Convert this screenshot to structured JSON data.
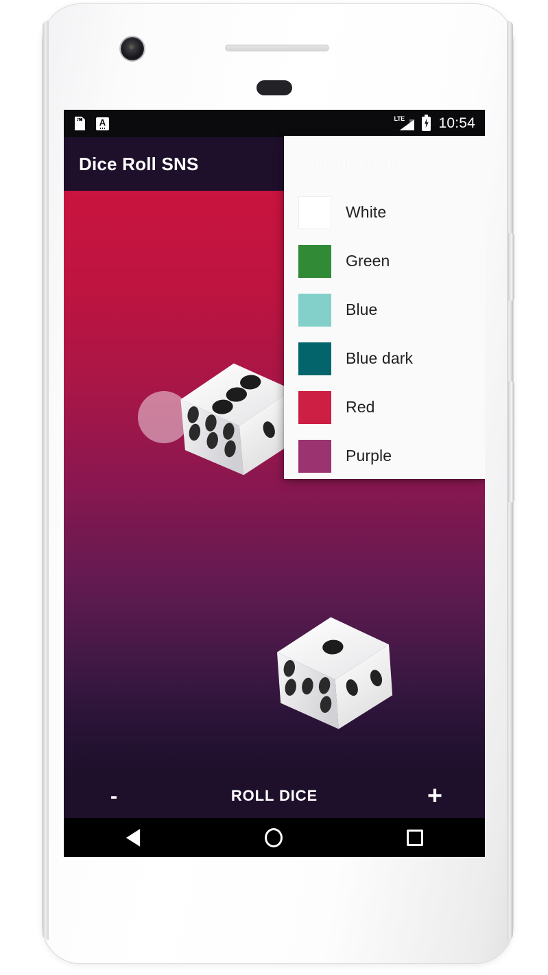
{
  "app": {
    "title": "Dice Roll SNS",
    "accent_bar_color": "#1e0f2b",
    "background_gradient_top": "#c8143f",
    "background_gradient_bottom": "#1e0f2b"
  },
  "status_bar": {
    "clock": "10:54",
    "network_label": "LTE",
    "icons": [
      "sd-card-icon",
      "auto-brightness-icon",
      "lte-signal-icon",
      "battery-charging-icon"
    ]
  },
  "dice": [
    {
      "name": "die-one",
      "top_face": 3,
      "left_face": 6,
      "right_face": 1
    },
    {
      "name": "die-two",
      "top_face": 1,
      "left_face": 5,
      "right_face": 2
    }
  ],
  "action_bar": {
    "minus_label": "-",
    "roll_label": "ROLL DICE",
    "plus_label": "+"
  },
  "nav_bar": {
    "back_label": "Back",
    "home_label": "Home",
    "recents_label": "Recents"
  },
  "dropdown": {
    "header": "Change color",
    "items": [
      {
        "label": "White",
        "color": "#ffffff"
      },
      {
        "label": "Green",
        "color": "#318a35"
      },
      {
        "label": "Blue",
        "color": "#83cfc9"
      },
      {
        "label": "Blue dark",
        "color": "#03656b"
      },
      {
        "label": "Red",
        "color": "#cc1f43"
      },
      {
        "label": "Purple",
        "color": "#9b3371"
      }
    ]
  }
}
